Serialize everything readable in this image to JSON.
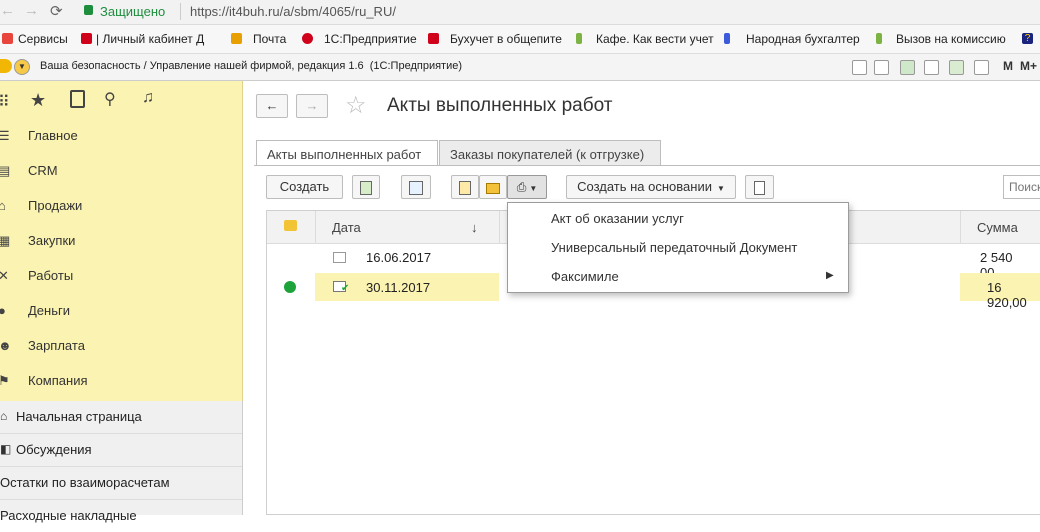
{
  "browser": {
    "secure_label": "Защищено",
    "url": "https://it4buh.ru/a/sbm/4065/ru_RU/"
  },
  "bookmarks": [
    {
      "label": "Сервисы",
      "color": "#e8453c"
    },
    {
      "label": "| Личный кабинет Д",
      "color": "#d0021b"
    },
    {
      "label": "Почта",
      "color": "#e8a000"
    },
    {
      "label": "1С:Предприятие",
      "color": "#d0021b"
    },
    {
      "label": "Бухучет в общепите",
      "color": "#d0021b"
    },
    {
      "label": "Кафе. Как вести учет",
      "color": "#7cb342"
    },
    {
      "label": "Народная бухгалтер",
      "color": "#3b5bdb"
    },
    {
      "label": "Вызов на комиссию",
      "color": "#7cb342"
    }
  ],
  "app": {
    "title": "Ваша безопасность / Управление нашей фирмой, редакция 1.6",
    "platform": "(1С:Предприятие)",
    "mem_labels": [
      "M",
      "M+"
    ]
  },
  "sidebar": {
    "items": [
      {
        "label": "Главное",
        "icon": "menu-icon"
      },
      {
        "label": "CRM",
        "icon": "crm-icon"
      },
      {
        "label": "Продажи",
        "icon": "sales-icon"
      },
      {
        "label": "Закупки",
        "icon": "purchases-icon"
      },
      {
        "label": "Работы",
        "icon": "tools-icon"
      },
      {
        "label": "Деньги",
        "icon": "money-icon"
      },
      {
        "label": "Зарплата",
        "icon": "salary-icon"
      },
      {
        "label": "Компания",
        "icon": "company-icon"
      }
    ],
    "panel_items": [
      {
        "label": "Начальная страница"
      },
      {
        "label": "Обсуждения"
      },
      {
        "label": "Остатки по взаиморасчетам"
      },
      {
        "label": "Расходные накладные"
      }
    ]
  },
  "form": {
    "title": "Акты выполненных работ",
    "tabs": [
      {
        "label": "Акты выполненных работ",
        "active": true
      },
      {
        "label": "Заказы покупателей (к отгрузке)",
        "active": false
      }
    ],
    "toolbar": {
      "create_label": "Создать",
      "create_based_label": "Создать на основании",
      "search_placeholder": "Поиск"
    },
    "table": {
      "columns": [
        "Дата",
        "Сумма"
      ],
      "sort_indicator": "↓",
      "rows": [
        {
          "date": "16.06.2017",
          "sum": "2 540 00...",
          "selected": false,
          "status": ""
        },
        {
          "date": "30.11.2017",
          "sum": "16 920,00",
          "selected": true,
          "status": "green"
        }
      ]
    }
  },
  "print_menu": {
    "items": [
      {
        "label": "Акт об оказании услуг"
      },
      {
        "label": "Универсальный передаточный Документ"
      },
      {
        "label": "Факсимиле",
        "submenu": true
      }
    ]
  },
  "colors": {
    "sidebar_bg": "#fbf3b1",
    "selected_row": "#fbf3b1",
    "status_green": "#1ea33a"
  }
}
